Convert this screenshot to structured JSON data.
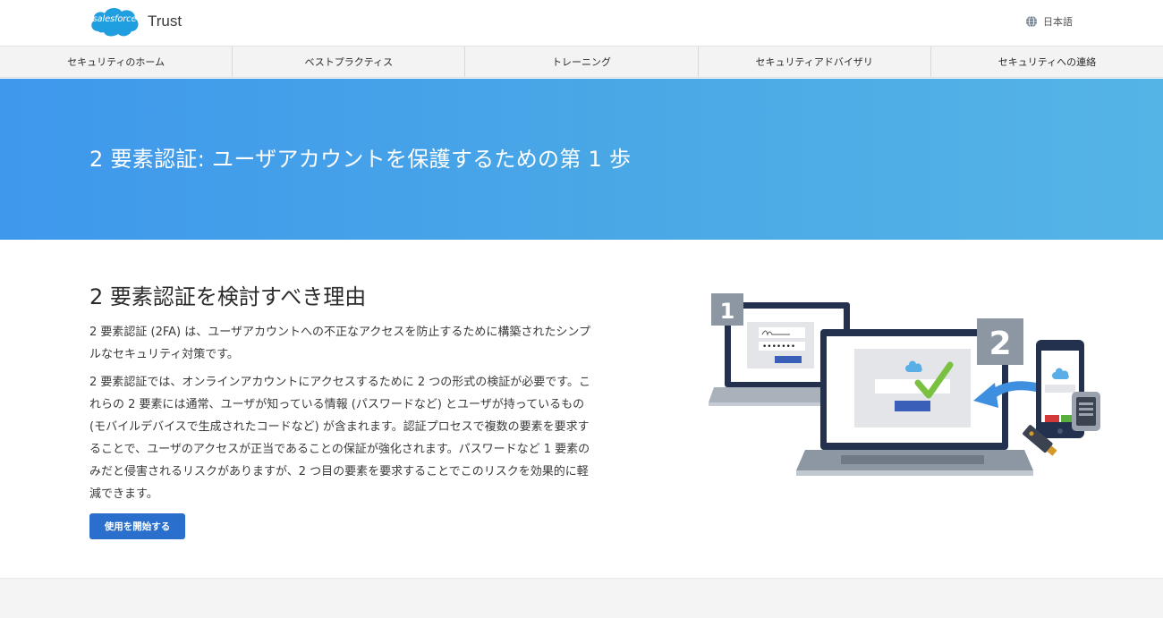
{
  "header": {
    "brand": "salesforce",
    "trust_label": "Trust",
    "language": "日本語"
  },
  "nav": {
    "items": [
      {
        "label": "セキュリティのホーム"
      },
      {
        "label": "ベストプラクティス"
      },
      {
        "label": "トレーニング"
      },
      {
        "label": "セキュリティアドバイザリ"
      },
      {
        "label": "セキュリティへの連絡"
      }
    ]
  },
  "hero": {
    "title": "2 要素認証: ユーザアカウントを保護するための第 1 歩"
  },
  "main": {
    "heading": "2 要素認証を検討すべき理由",
    "paragraphs": [
      "2 要素認証 (2FA) は、ユーザアカウントへの不正なアクセスを防止するために構築されたシンプルなセキュリティ対策です。",
      "2 要素認証では、オンラインアカウントにアクセスするために 2 つの形式の検証が必要です。これらの 2 要素には通常、ユーザが知っている情報 (パスワードなど) とユーザが持っているもの (モバイルデバイスで生成されたコードなど) が含まれます。認証プロセスで複数の要素を要求することで、ユーザのアクセスが正当であることの保証が強化されます。パスワードなど 1 要素のみだと侵害されるリスクがありますが、2 つ目の要素を要求することでこのリスクを効果的に軽減できます。"
    ],
    "cta_label": "使用を開始する"
  },
  "illustration": {
    "step1": "1",
    "step2": "2",
    "password_mask": "•••••••",
    "colors": {
      "dark_navy": "#23314f",
      "gray_badge": "#8c97a3",
      "blue_arrow": "#3f8fe0",
      "green_check": "#7ac142",
      "button_blue": "#3a5fb8",
      "cloud_blue": "#5aaee6"
    }
  },
  "colors": {
    "hero_start": "#3f98ec",
    "hero_end": "#55b4e6",
    "cta": "#2a6fcc",
    "logo": "#1f9ee0"
  }
}
